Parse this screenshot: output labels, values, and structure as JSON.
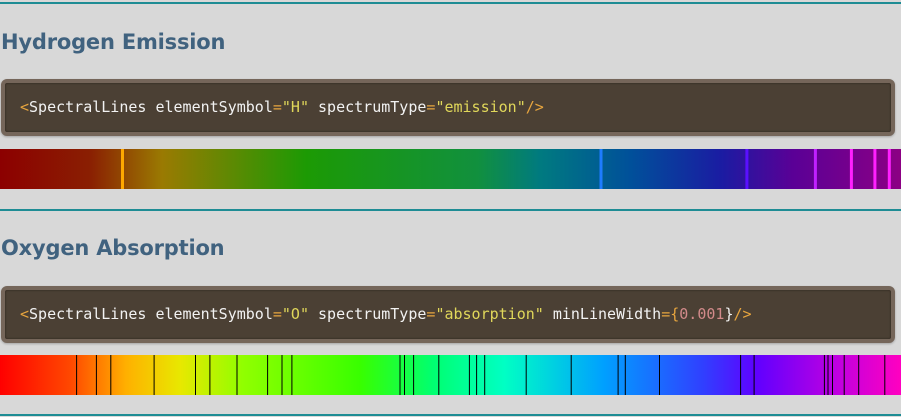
{
  "sections": [
    {
      "title": "Hydrogen Emission",
      "code": {
        "tag_open": "<",
        "component": "SpectralLines",
        "attr1_name": "elementSymbol",
        "attr1_value": "\"H\"",
        "attr2_name": "spectrumType",
        "attr2_value": "\"emission\"",
        "tag_close": "/>"
      },
      "spectrum": {
        "type": "emission",
        "line_positions": [
          0.136,
          0.667,
          0.829,
          0.905,
          0.945,
          0.971,
          0.987
        ]
      }
    },
    {
      "title": "Oxygen Absorption",
      "code": {
        "tag_open": "<",
        "component": "SpectralLines",
        "attr1_name": "elementSymbol",
        "attr1_value": "\"O\"",
        "attr2_name": "spectrumType",
        "attr2_value": "\"absorption\"",
        "attr3_name": "minLineWidth",
        "attr3_brace_open": "={",
        "attr3_value": "0.001",
        "attr3_brace_close": "}",
        "tag_close": "/>"
      },
      "spectrum": {
        "type": "absorption",
        "line_positions": [
          0.085,
          0.107,
          0.123,
          0.171,
          0.217,
          0.233,
          0.263,
          0.297,
          0.313,
          0.324,
          0.444,
          0.449,
          0.459,
          0.487,
          0.521,
          0.529,
          0.538,
          0.584,
          0.634,
          0.686,
          0.694,
          0.732,
          0.822,
          0.837,
          0.915,
          0.919,
          0.924,
          0.937,
          0.953,
          0.982
        ]
      }
    }
  ],
  "colors": {
    "rule": "#1e8c94",
    "heading": "#40627f",
    "code_bg": "#4b4034",
    "code_border": "#75665a",
    "punctuation": "#e7a53e",
    "string": "#e0d75a",
    "number": "#d28a8a"
  }
}
